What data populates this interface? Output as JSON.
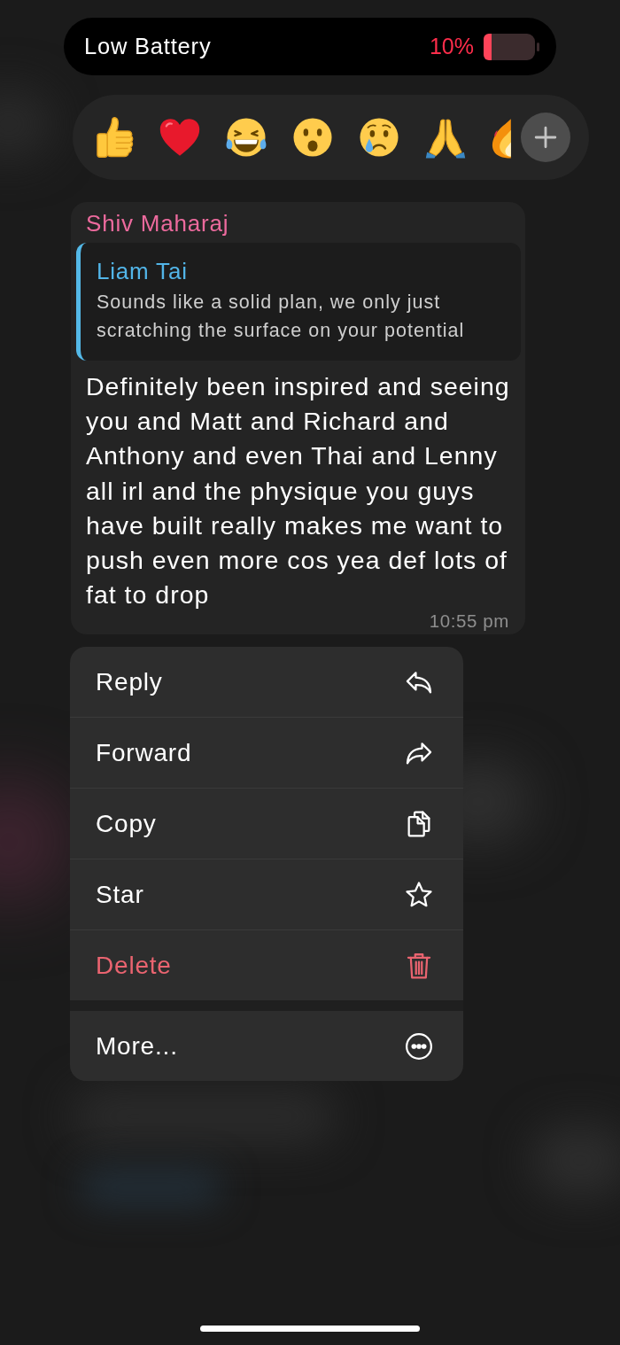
{
  "battery_alert": {
    "label": "Low Battery",
    "percent": "10%"
  },
  "reactions": [
    {
      "kind": "thumbsup"
    },
    {
      "kind": "heart"
    },
    {
      "kind": "laugh"
    },
    {
      "kind": "surprise"
    },
    {
      "kind": "cry"
    },
    {
      "kind": "pray"
    },
    {
      "kind": "fire"
    }
  ],
  "message": {
    "sender": "Shiv Maharaj",
    "reply_to": {
      "sender": "Liam Tai",
      "text": "Sounds like a solid plan, we only just scratching the surface on your potential"
    },
    "text": "Definitely been inspired and seeing you and Matt and Richard and Anthony and even Thai and Lenny all irl and the physique you guys have built really makes me want to push even more cos yea def lots of fat to drop",
    "time": "10:55 pm"
  },
  "context_menu": {
    "groups": [
      {
        "items": [
          {
            "label": "Reply",
            "kind": "reply",
            "destructive": false
          },
          {
            "label": "Forward",
            "kind": "forward",
            "destructive": false
          },
          {
            "label": "Copy",
            "kind": "copy",
            "destructive": false
          },
          {
            "label": "Star",
            "kind": "star",
            "destructive": false
          },
          {
            "label": "Delete",
            "kind": "delete",
            "destructive": true
          }
        ]
      },
      {
        "items": [
          {
            "label": "More...",
            "kind": "more",
            "destructive": false
          }
        ]
      }
    ]
  }
}
